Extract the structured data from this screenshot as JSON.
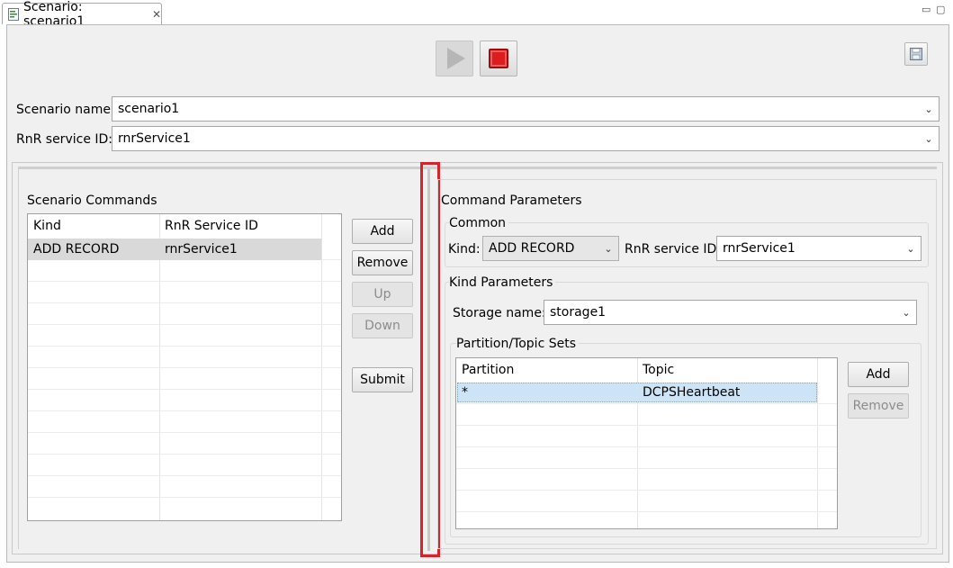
{
  "tab": {
    "title": "Scenario: scenario1",
    "close": "✕"
  },
  "window_controls": {
    "minimize": "▭",
    "maximize": "▢"
  },
  "toolbar": {
    "play_icon": "play-icon",
    "stop_icon": "stop-icon",
    "save_icon": "save-icon"
  },
  "scenario": {
    "name_label": "Scenario name:",
    "name_value": "scenario1",
    "service_label": "RnR service ID:",
    "service_value": "rnrService1"
  },
  "commands": {
    "title": "Scenario Commands",
    "columns": [
      "Kind",
      "RnR Service ID"
    ],
    "rows": [
      {
        "kind": "ADD RECORD",
        "service": "rnrService1"
      }
    ],
    "buttons": {
      "add": "Add",
      "remove": "Remove",
      "up": "Up",
      "down": "Down",
      "submit": "Submit"
    }
  },
  "parameters": {
    "title": "Command Parameters",
    "common": {
      "title": "Common",
      "kind_label": "Kind:",
      "kind_value": "ADD RECORD",
      "service_label": "RnR service ID:",
      "service_value": "rnrService1"
    },
    "kind_params": {
      "title": "Kind Parameters",
      "storage_label": "Storage name:",
      "storage_value": "storage1"
    },
    "sets": {
      "title": "Partition/Topic Sets",
      "columns": [
        "Partition",
        "Topic"
      ],
      "rows": [
        {
          "partition": "*",
          "topic": "DCPSHeartbeat"
        }
      ],
      "buttons": {
        "add": "Add",
        "remove": "Remove"
      }
    }
  },
  "colors": {
    "highlight_box": "#d9232a",
    "stop_red": "#dc1d1d",
    "row_selected": "#d7d7d7",
    "row_selected_blue": "#cde4f7"
  }
}
